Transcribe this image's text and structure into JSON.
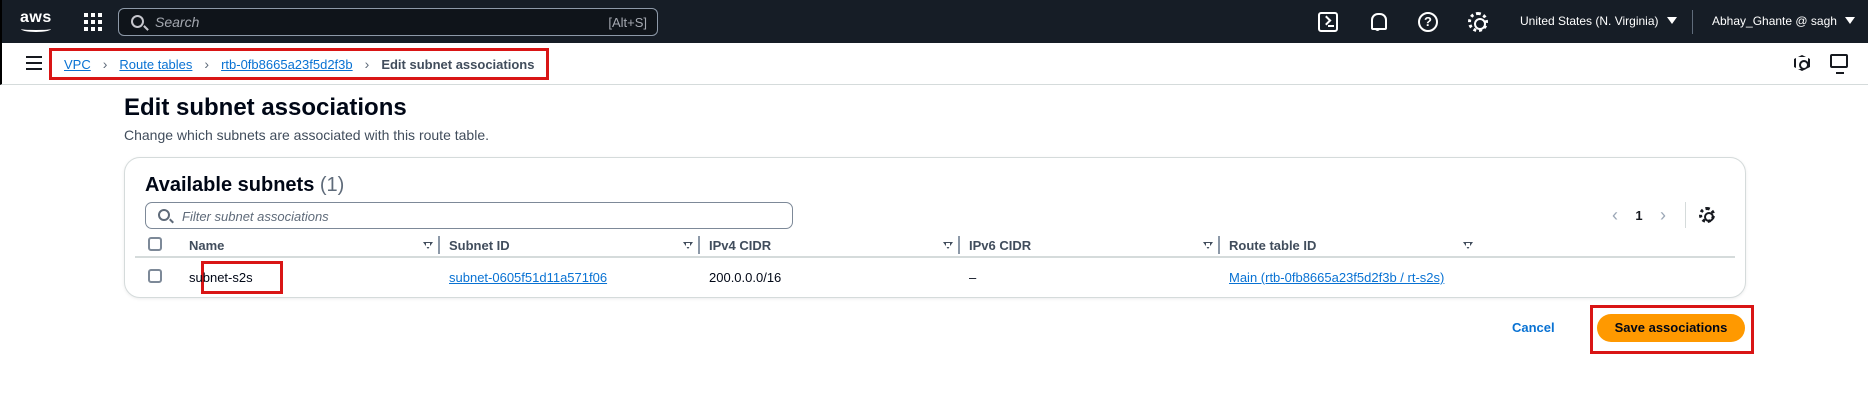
{
  "topnav": {
    "logo_text": "aws",
    "search_placeholder": "Search",
    "search_shortcut": "[Alt+S]",
    "help_glyph": "?",
    "region": "United States (N. Virginia)",
    "user": "Abhay_Ghante @ sagh",
    "icons": [
      "apps-icon",
      "search-icon",
      "cloudshell-icon",
      "bell-icon",
      "help-icon",
      "settings-icon"
    ]
  },
  "breadcrumb": {
    "items": [
      "VPC",
      "Route tables",
      "rtb-0fb8665a23f5d2f3b"
    ],
    "current": "Edit subnet associations"
  },
  "page": {
    "title": "Edit subnet associations",
    "description": "Change which subnets are associated with this route table."
  },
  "subnets": {
    "title": "Available subnets",
    "count": "(1)",
    "filter_placeholder": "Filter subnet associations",
    "page": "1",
    "prev_glyph": "‹",
    "next_glyph": "›",
    "columns": [
      "Name",
      "Subnet ID",
      "IPv4 CIDR",
      "IPv6 CIDR",
      "Route table ID"
    ],
    "rows": [
      {
        "name": "subnet-s2s",
        "subnet_id": "subnet-0605f51d11a571f06",
        "ipv4": "200.0.0.0/16",
        "ipv6": "–",
        "route_table": "Main (rtb-0fb8665a23f5d2f3b / rt-s2s)",
        "selected": false
      }
    ]
  },
  "actions": {
    "cancel": "Cancel",
    "save": "Save associations"
  },
  "colors": {
    "nav_bg": "#161d26",
    "link": "#0972d3",
    "primary_button": "#ff9900",
    "highlight": "#d91515"
  }
}
